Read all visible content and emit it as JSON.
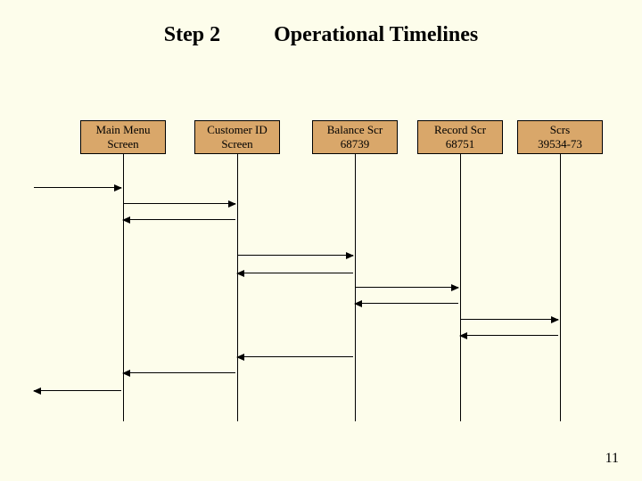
{
  "title": {
    "step": "Step 2",
    "main": "Operational Timelines"
  },
  "boxes": [
    {
      "line1": "Main Menu",
      "line2": "Screen"
    },
    {
      "line1": "Customer ID",
      "line2": "Screen"
    },
    {
      "line1": "Balance Scr",
      "line2": "68739"
    },
    {
      "line1": "Record Scr",
      "line2": "68751"
    },
    {
      "line1": "Scrs",
      "line2": "39534-73"
    }
  ],
  "page_number": "11"
}
